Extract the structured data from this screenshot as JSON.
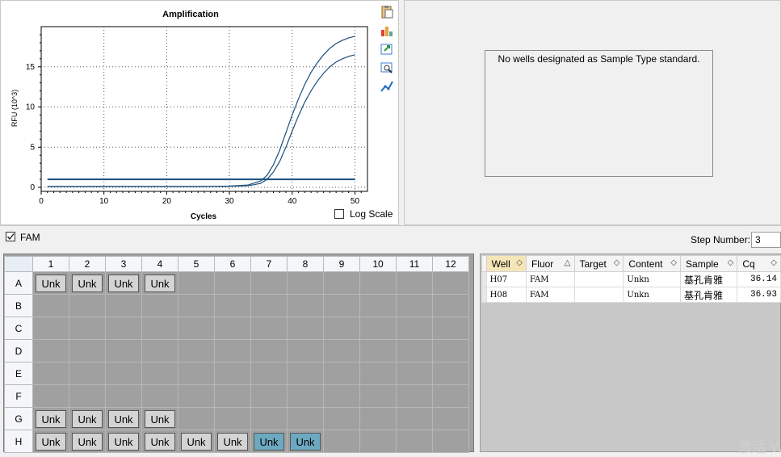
{
  "chart": {
    "title": "Amplification",
    "xlabel": "Cycles",
    "ylabel": "RFU (10^3)",
    "log_scale_label": "Log Scale"
  },
  "chart_data": {
    "type": "line",
    "title": "Amplification",
    "xlabel": "Cycles",
    "ylabel": "RFU (10^3)",
    "xlim": [
      0,
      52
    ],
    "ylim": [
      -0.5,
      20
    ],
    "xticks": [
      0,
      10,
      20,
      30,
      40,
      50
    ],
    "yticks": [
      0,
      5,
      10,
      15
    ],
    "grid": true,
    "threshold": 1.0,
    "series": [
      {
        "color": "#1a4e7e",
        "x": [
          1,
          5,
          10,
          15,
          20,
          25,
          30,
          33,
          35,
          36,
          37,
          38,
          39,
          40,
          41,
          42,
          43,
          44,
          45,
          46,
          47,
          48,
          49,
          50
        ],
        "values": [
          0.1,
          0.1,
          0.1,
          0.1,
          0.1,
          0.1,
          0.15,
          0.3,
          0.8,
          1.5,
          2.8,
          4.6,
          6.8,
          9.0,
          11.0,
          12.8,
          14.3,
          15.5,
          16.5,
          17.3,
          17.9,
          18.3,
          18.6,
          18.8
        ]
      },
      {
        "color": "#1a4e7e",
        "x": [
          1,
          5,
          10,
          15,
          20,
          25,
          30,
          33,
          35,
          36,
          37,
          38,
          39,
          40,
          41,
          42,
          43,
          44,
          45,
          46,
          47,
          48,
          49,
          50
        ],
        "values": [
          0.1,
          0.1,
          0.1,
          0.1,
          0.1,
          0.1,
          0.12,
          0.2,
          0.5,
          1.0,
          1.9,
          3.2,
          5.0,
          7.0,
          8.9,
          10.6,
          12.0,
          13.2,
          14.2,
          15.0,
          15.6,
          16.0,
          16.3,
          16.5
        ]
      }
    ]
  },
  "standard": {
    "message": "No wells designated as Sample Type standard."
  },
  "filter": {
    "fam_label": "FAM",
    "fam_checked": true
  },
  "step": {
    "label": "Step Number:",
    "value": "3"
  },
  "plate": {
    "columns": [
      "1",
      "2",
      "3",
      "4",
      "5",
      "6",
      "7",
      "8",
      "9",
      "10",
      "11",
      "12"
    ],
    "rows": [
      {
        "label": "A",
        "wells": [
          "Unk",
          "Unk",
          "Unk",
          "Unk",
          "",
          "",
          "",
          "",
          "",
          "",
          "",
          ""
        ]
      },
      {
        "label": "B",
        "wells": [
          "",
          "",
          "",
          "",
          "",
          "",
          "",
          "",
          "",
          "",
          "",
          ""
        ]
      },
      {
        "label": "C",
        "wells": [
          "",
          "",
          "",
          "",
          "",
          "",
          "",
          "",
          "",
          "",
          "",
          ""
        ]
      },
      {
        "label": "D",
        "wells": [
          "",
          "",
          "",
          "",
          "",
          "",
          "",
          "",
          "",
          "",
          "",
          ""
        ]
      },
      {
        "label": "E",
        "wells": [
          "",
          "",
          "",
          "",
          "",
          "",
          "",
          "",
          "",
          "",
          "",
          ""
        ]
      },
      {
        "label": "F",
        "wells": [
          "",
          "",
          "",
          "",
          "",
          "",
          "",
          "",
          "",
          "",
          "",
          ""
        ]
      },
      {
        "label": "G",
        "wells": [
          "Unk",
          "Unk",
          "Unk",
          "Unk",
          "",
          "",
          "",
          "",
          "",
          "",
          "",
          ""
        ]
      },
      {
        "label": "H",
        "wells": [
          "Unk",
          "Unk",
          "Unk",
          "Unk",
          "Unk",
          "Unk",
          "Unk",
          "Unk",
          "",
          "",
          "",
          ""
        ]
      }
    ],
    "selected": [
      "H7",
      "H8"
    ]
  },
  "results": {
    "headers": [
      "Well",
      "Fluor",
      "Target",
      "Content",
      "Sample",
      "Cq"
    ],
    "rows": [
      [
        "H07",
        "FAM",
        "",
        "Unkn",
        "基孔肯雅",
        "36.14"
      ],
      [
        "H08",
        "FAM",
        "",
        "Unkn",
        "基孔肯雅",
        "36.93"
      ]
    ]
  },
  "watermark": "激活 W",
  "icons": [
    "clipboard-icon",
    "chart-settings-icon",
    "export-icon",
    "zoom-chart-icon",
    "line-style-icon"
  ]
}
